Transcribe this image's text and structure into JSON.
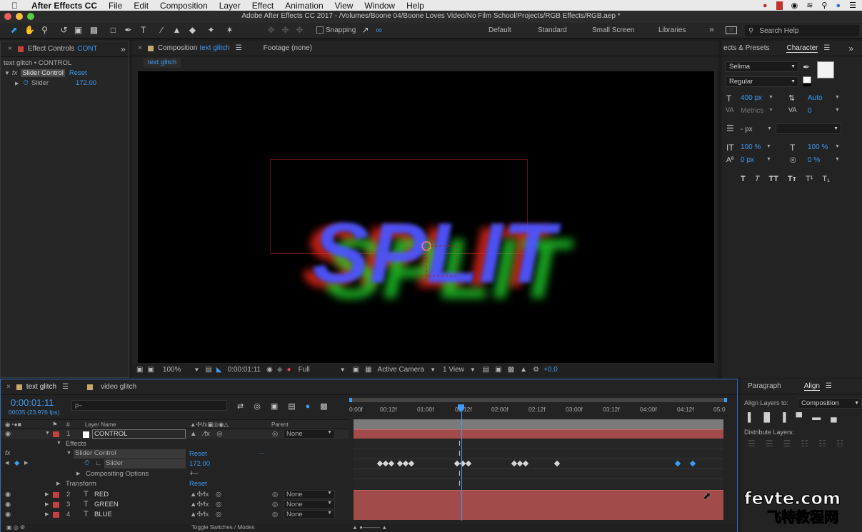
{
  "menubar": {
    "app_name": "After Effects CC",
    "items": [
      "File",
      "Edit",
      "Composition",
      "Layer",
      "Effect",
      "Animation",
      "View",
      "Window",
      "Help"
    ]
  },
  "window": {
    "title": "Adobe After Effects CC 2017 - /Volumes/Boone 04/Boone Loves Video/No Film School/Projects/RGB Effects/RGB.aep *"
  },
  "toolbar": {
    "snapping_label": "Snapping",
    "workspaces": [
      "Default",
      "Standard",
      "Small Screen",
      "Libraries"
    ],
    "active_workspace": "Standard",
    "search_help": "Search Help"
  },
  "effect_controls": {
    "tab_label": "Effect Controls",
    "tab_target": "CONT",
    "breadcrumb": "text glitch • CONTROL",
    "effect_name": "Slider Control",
    "reset_label": "Reset",
    "param_name": "Slider",
    "param_value": "172.00"
  },
  "composition": {
    "tab_label": "Composition",
    "tab_name": "text glitch",
    "footage_label": "Footage (none)",
    "sub_tab": "text glitch",
    "canvas_text": "SPLIT",
    "viewer_bar": {
      "zoom": "100%",
      "timecode": "0:00:01:11",
      "resolution": "Full",
      "camera": "Active Camera",
      "views": "1 View",
      "exposure": "+0.0"
    }
  },
  "character": {
    "tab_left": "ects & Presets",
    "tab": "Character",
    "font": "Selima",
    "style": "Regular",
    "font_size": "400 px",
    "leading": "Auto",
    "kerning": "Metrics",
    "tracking": "0",
    "stroke": "- px",
    "vscale": "100 %",
    "hscale": "100 %",
    "baseline": "0 px",
    "tsume": "0 %",
    "styles": [
      "T",
      "T",
      "TT",
      "Tт",
      "T¹",
      "T₁"
    ]
  },
  "timeline": {
    "tabs": [
      "text glitch",
      "video glitch"
    ],
    "timecode": "0:00:01:11",
    "frame_info": "00035 (23.976 fps)",
    "search_placeholder": "ρ–",
    "col_layer_name": "Layer Name",
    "col_parent": "Parent",
    "ruler": [
      "0:00f",
      "00:12f",
      "01:00f",
      "01:12f",
      "02:00f",
      "02:12f",
      "03:00f",
      "03:12f",
      "04:00f",
      "04:12f",
      "05:0"
    ],
    "layers": [
      {
        "num": "1",
        "name": "CONTROL",
        "parent": "None",
        "type": "solid"
      },
      {
        "num": "2",
        "name": "RED",
        "parent": "None",
        "type": "text"
      },
      {
        "num": "3",
        "name": "GREEN",
        "parent": "None",
        "type": "text"
      },
      {
        "num": "4",
        "name": "BLUE",
        "parent": "None",
        "type": "text"
      }
    ],
    "effects_label": "Effects",
    "slider_control_label": "Slider Control",
    "reset_label": "Reset",
    "dots": "...",
    "slider_label": "Slider",
    "slider_value": "172.00",
    "compositing_options": "Compositing Options",
    "plus_minus": "+–",
    "transform_label": "Transform",
    "transform_reset": "Reset",
    "toggle_label": "Toggle Switches / Modes",
    "marker_i": "I"
  },
  "align": {
    "tab_left": "Paragraph",
    "tab": "Align",
    "align_to_label": "Align Layers to:",
    "align_to_value": "Composition",
    "distribute_label": "Distribute Layers:"
  },
  "watermark": {
    "latin": "fevte.com",
    "cjk": "飞特教程网"
  },
  "colors": {
    "accent": "#3d9bf0",
    "layer_bar": "#a14b4b",
    "panel": "#232323"
  }
}
